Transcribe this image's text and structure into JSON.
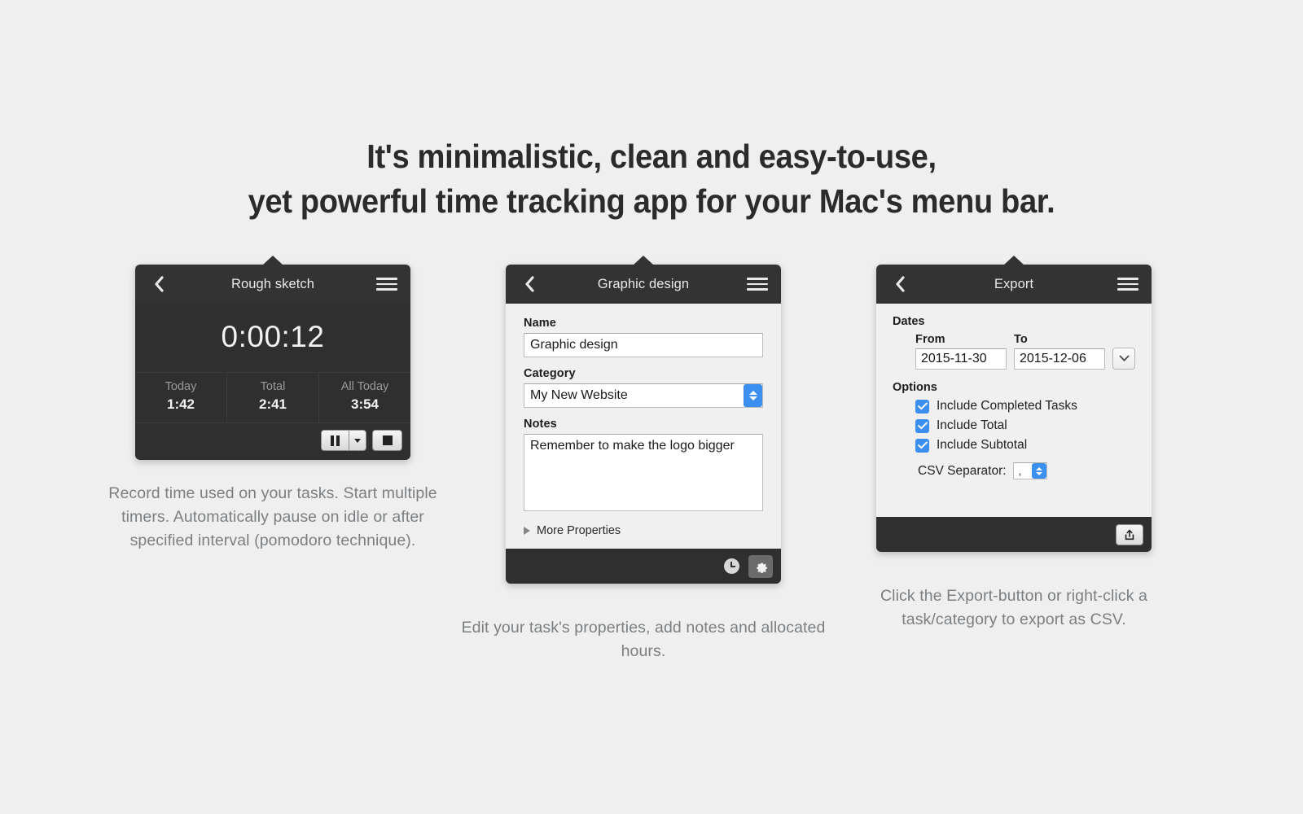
{
  "headline": {
    "line1": "It's minimalistic, clean and easy-to-use,",
    "line2": "yet powerful time tracking app for your Mac's menu bar."
  },
  "colors": {
    "page_background": "#efefef",
    "titlebar": "#333333",
    "panel_body": "#f0f0f0",
    "timer_body": "#2f2f2f",
    "accent_blue": "#3b8ff0",
    "caption_text": "#7b7f82",
    "headline_text": "#2b2b2b"
  },
  "panels": {
    "timer": {
      "title": "Rough sketch",
      "back_icon": "chevron-left-icon",
      "menu_icon": "hamburger-menu-icon",
      "elapsed": "0:00:12",
      "stats": [
        {
          "label": "Today",
          "value": "1:42"
        },
        {
          "label": "Total",
          "value": "2:41"
        },
        {
          "label": "All Today",
          "value": "3:54"
        }
      ],
      "pause_icon": "pause-icon",
      "pause_dropdown_icon": "caret-down-icon",
      "stop_icon": "stop-icon",
      "caption": "Record time used on your tasks. Start multiple timers. Automatically pause on idle or after specified interval (pomodoro technique)."
    },
    "properties": {
      "title": "Graphic design",
      "back_icon": "chevron-left-icon",
      "menu_icon": "hamburger-menu-icon",
      "fields": {
        "name_label": "Name",
        "name_value": "Graphic design",
        "category_label": "Category",
        "category_value": "My New Website",
        "category_stepper_icon": "stepper-up-down-icon",
        "notes_label": "Notes",
        "notes_value": "Remember to make the logo bigger"
      },
      "more_properties_label": "More Properties",
      "disclosure_icon": "triangle-right-icon",
      "footer": {
        "clock_icon": "clock-icon",
        "settings_icon": "gear-icon"
      },
      "caption": "Edit your task's properties, add notes and allocated hours."
    },
    "export": {
      "title": "Export",
      "back_icon": "chevron-left-icon",
      "menu_icon": "hamburger-menu-icon",
      "dates_section": "Dates",
      "from_label": "From",
      "from_value": "2015-11-30",
      "to_label": "To",
      "to_value": "2015-12-06",
      "calendar_icon": "chevron-down-icon",
      "options_section": "Options",
      "options": [
        {
          "label": "Include Completed Tasks",
          "checked": true
        },
        {
          "label": "Include Total",
          "checked": true
        },
        {
          "label": "Include Subtotal",
          "checked": true
        }
      ],
      "csv_separator_label": "CSV Separator:",
      "csv_separator_value": ",",
      "csv_stepper_icon": "stepper-up-down-icon",
      "share_icon": "share-export-icon",
      "caption": "Click the Export-button or right-click a task/category to export as CSV."
    }
  }
}
